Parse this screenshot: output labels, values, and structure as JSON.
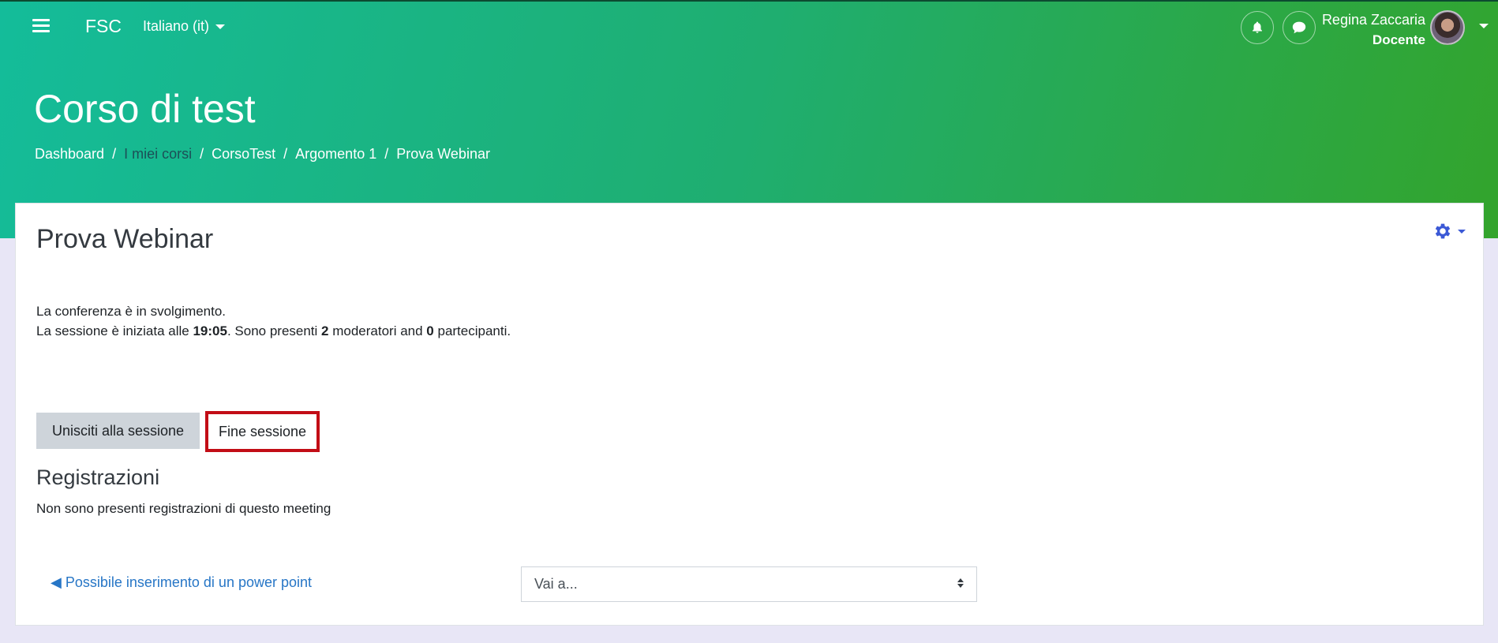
{
  "navbar": {
    "brand": "FSC",
    "language": "Italiano (it)",
    "user": {
      "name": "Regina Zaccaria",
      "role": "Docente"
    },
    "icons": {
      "menu": "hamburger-menu-icon",
      "notifications": "bell-icon",
      "messages": "chat-bubble-icon",
      "user_menu": "chevron-down-icon"
    }
  },
  "header": {
    "course_title": "Corso di test",
    "breadcrumb": [
      "Dashboard",
      "I miei corsi",
      "CorsoTest",
      "Argomento 1",
      "Prova Webinar"
    ]
  },
  "main": {
    "title": "Prova Webinar",
    "status_line1": "La conferenza è in svolgimento.",
    "status_line2": {
      "prefix": "La sessione è iniziata alle ",
      "time": "19:05",
      "middle": ". Sono presenti ",
      "moderators": "2",
      "moderators_label": " moderatori and ",
      "participants": "0",
      "participants_label": " partecipanti."
    },
    "join_button": "Unisciti alla sessione",
    "end_button": "Fine sessione",
    "recordings_title": "Registrazioni",
    "recordings_empty": "Non sono presenti registrazioni di questo meeting",
    "prev_link": "◀ Possibile inserimento di un power point",
    "jump_select": "Vai a...",
    "accent_color": "#3b59d6",
    "highlight_color": "#c20d16"
  }
}
